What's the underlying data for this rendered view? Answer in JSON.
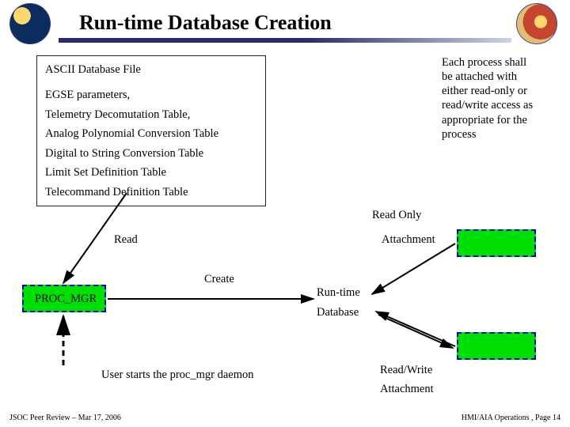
{
  "title": "Run-time Database Creation",
  "ascii": {
    "heading": "ASCII Database File",
    "items": [
      "EGSE parameters,",
      "Telemetry Decomutation Table,",
      "Analog Polynomial Conversion Table",
      "Digital to String Conversion Table",
      "Limit Set Definition Table",
      "Telecommand Definition Table"
    ]
  },
  "note": "Each process shall be attached with either read-only or read/write access as appropriate for the process",
  "labels": {
    "read_only": "Read Only",
    "read": "Read",
    "attachment_top": "Attachment",
    "create": "Create",
    "proc_mgr": "PROC_MGR",
    "runtime": "Run-time",
    "database": "Database",
    "user_start": "User starts the proc_mgr daemon",
    "read_write": "Read/Write",
    "attachment_bot": "Attachment"
  },
  "footer": {
    "left": "JSOC Peer Review – Mar 17, 2006",
    "right": "HMI/AIA Operations , Page 14"
  }
}
